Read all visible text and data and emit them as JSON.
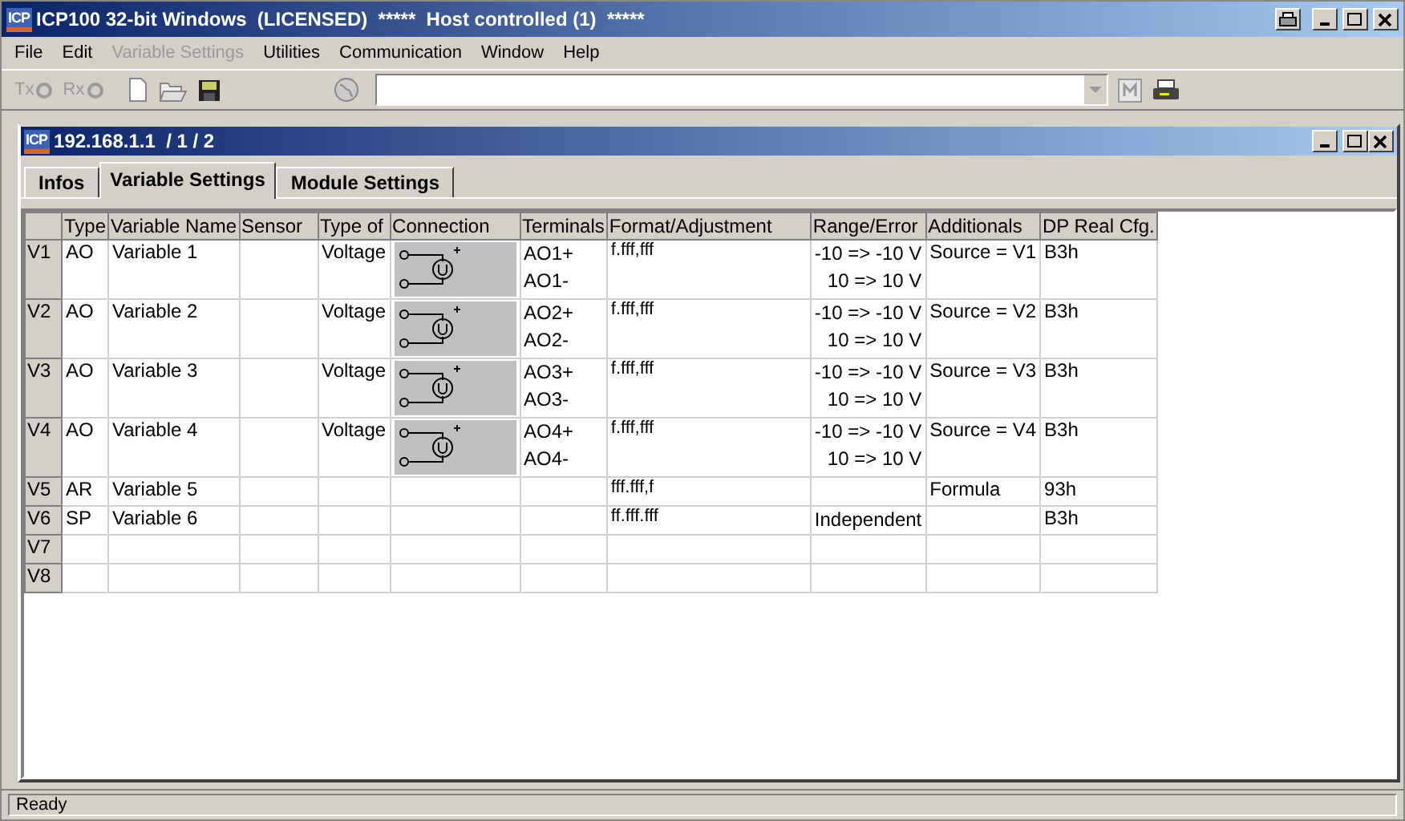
{
  "window": {
    "logo": "ICP",
    "title": "ICP100 32-bit Windows  (LICENSED)  *****  Host controlled (1)  *****"
  },
  "menu": [
    {
      "label": "File",
      "disabled": false
    },
    {
      "label": "Edit",
      "disabled": false
    },
    {
      "label": "Variable Settings",
      "disabled": true
    },
    {
      "label": "Utilities",
      "disabled": false
    },
    {
      "label": "Communication",
      "disabled": false
    },
    {
      "label": "Window",
      "disabled": false
    },
    {
      "label": "Help",
      "disabled": false
    }
  ],
  "toolbar": {
    "tx": {
      "label": "Tx",
      "disabled": true
    },
    "rx": {
      "label": "Rx",
      "disabled": true
    }
  },
  "child": {
    "logo": "ICP",
    "title": "192.168.1.1  / 1 / 2",
    "tabs": [
      {
        "label": "Infos",
        "selected": false
      },
      {
        "label": "Variable Settings",
        "selected": true
      },
      {
        "label": "Module Settings",
        "selected": false
      }
    ],
    "table": {
      "columns": [
        "Type",
        "Variable Name",
        "Sensor",
        "Type of",
        "Connection",
        "Terminals",
        "Format/Adjustment",
        "Range/Error",
        "Additionals",
        "DP Real Cfg."
      ],
      "rows": [
        {
          "id": "V1",
          "type": "AO",
          "name": "Variable 1",
          "type_of": "Voltage",
          "connection": true,
          "terminals": [
            "AO1+",
            "AO1-"
          ],
          "format": "f.fff,fff",
          "range": [
            "-10 => -10 V",
            "10 => 10 V"
          ],
          "additionals": "Source = V1",
          "dp": "B3h"
        },
        {
          "id": "V2",
          "type": "AO",
          "name": "Variable 2",
          "type_of": "Voltage",
          "connection": true,
          "terminals": [
            "AO2+",
            "AO2-"
          ],
          "format": "f.fff,fff",
          "range": [
            "-10 => -10 V",
            "10 => 10 V"
          ],
          "additionals": "Source = V2",
          "dp": "B3h"
        },
        {
          "id": "V3",
          "type": "AO",
          "name": "Variable 3",
          "type_of": "Voltage",
          "connection": true,
          "terminals": [
            "AO3+",
            "AO3-"
          ],
          "format": "f.fff,fff",
          "range": [
            "-10 => -10 V",
            "10 => 10 V"
          ],
          "additionals": "Source = V3",
          "dp": "B3h"
        },
        {
          "id": "V4",
          "type": "AO",
          "name": "Variable 4",
          "type_of": "Voltage",
          "connection": true,
          "terminals": [
            "AO4+",
            "AO4-"
          ],
          "format": "f.fff,fff",
          "range": [
            "-10 => -10 V",
            "10 => 10 V"
          ],
          "additionals": "Source = V4",
          "dp": "B3h"
        },
        {
          "id": "V5",
          "type": "AR",
          "name": "Variable 5",
          "format": "fff.fff,f",
          "additionals": "Formula",
          "dp": "93h"
        },
        {
          "id": "V6",
          "type": "SP",
          "name": "Variable 6",
          "format": "ff.fff.fff",
          "range": [
            "Independent"
          ],
          "dp": "B3h"
        },
        {
          "id": "V7"
        },
        {
          "id": "V8"
        }
      ]
    }
  },
  "status_bar": "Ready"
}
